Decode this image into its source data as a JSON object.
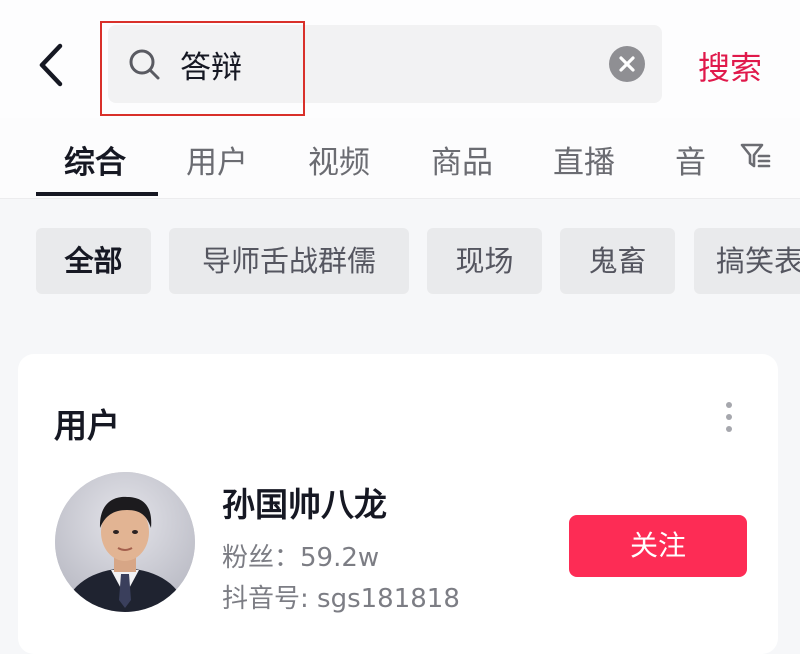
{
  "search": {
    "query": "答辩",
    "submit_label": "搜索"
  },
  "tabs": [
    {
      "label": "综合",
      "active": true
    },
    {
      "label": "用户"
    },
    {
      "label": "视频"
    },
    {
      "label": "商品"
    },
    {
      "label": "直播"
    },
    {
      "label": "音"
    }
  ],
  "chips": [
    {
      "label": "全部",
      "active": true
    },
    {
      "label": "导师舌战群儒"
    },
    {
      "label": "现场"
    },
    {
      "label": "鬼畜"
    },
    {
      "label": "搞笑表"
    }
  ],
  "user_section": {
    "title": "用户",
    "user": {
      "name": "孙国帅八龙",
      "fans": "粉丝：59.2w",
      "douyin_id": "抖音号: sgs181818",
      "follow_label": "关注"
    }
  },
  "colors": {
    "accent": "#fd2c55",
    "search_link": "#e0194b",
    "highlight_box": "#d9302a"
  },
  "icons": [
    "back-arrow-icon",
    "search-icon",
    "clear-icon",
    "filter-icon",
    "more-vertical-icon"
  ]
}
